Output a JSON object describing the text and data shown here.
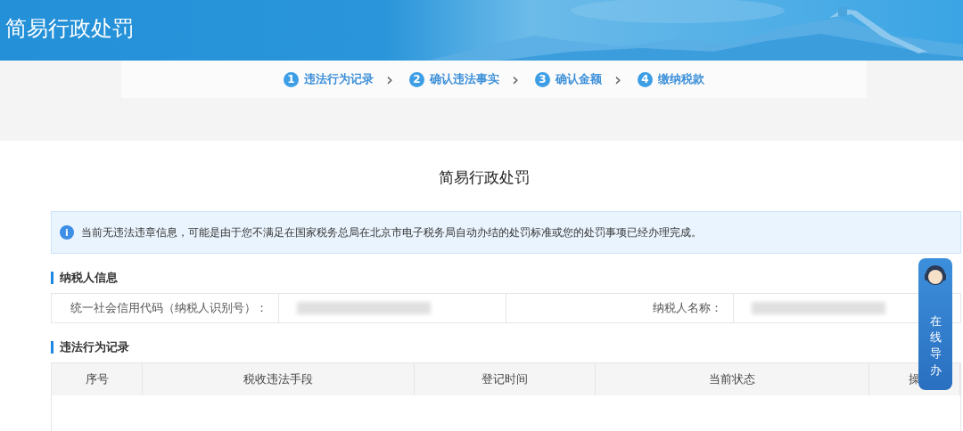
{
  "header": {
    "title": "简易行政处罚"
  },
  "steps": [
    {
      "number": "1",
      "label": "违法行为记录",
      "arrow": "›"
    },
    {
      "number": "2",
      "label": "确认违法事实",
      "arrow": "›"
    },
    {
      "number": "3",
      "label": "确认金额",
      "arrow": "›"
    },
    {
      "number": "4",
      "label": "缴纳税款"
    }
  ],
  "page_title": "简易行政处罚",
  "notice": {
    "icon": "i",
    "text": "当前无违法违章信息，可能是由于您不满足在国家税务总局在北京市电子税务局自动办结的处罚标准或您的处罚事项已经办理完成。"
  },
  "taxpayer_section": {
    "heading": "纳税人信息",
    "fields": [
      {
        "label": "统一社会信用代码（纳税人识别号）："
      },
      {
        "label": "纳税人名称："
      }
    ]
  },
  "records_section": {
    "heading": "违法行为记录",
    "columns": [
      "序号",
      "税收违法手段",
      "登记时间",
      "当前状态",
      "操"
    ]
  },
  "helper": {
    "label": "在线导办"
  }
}
